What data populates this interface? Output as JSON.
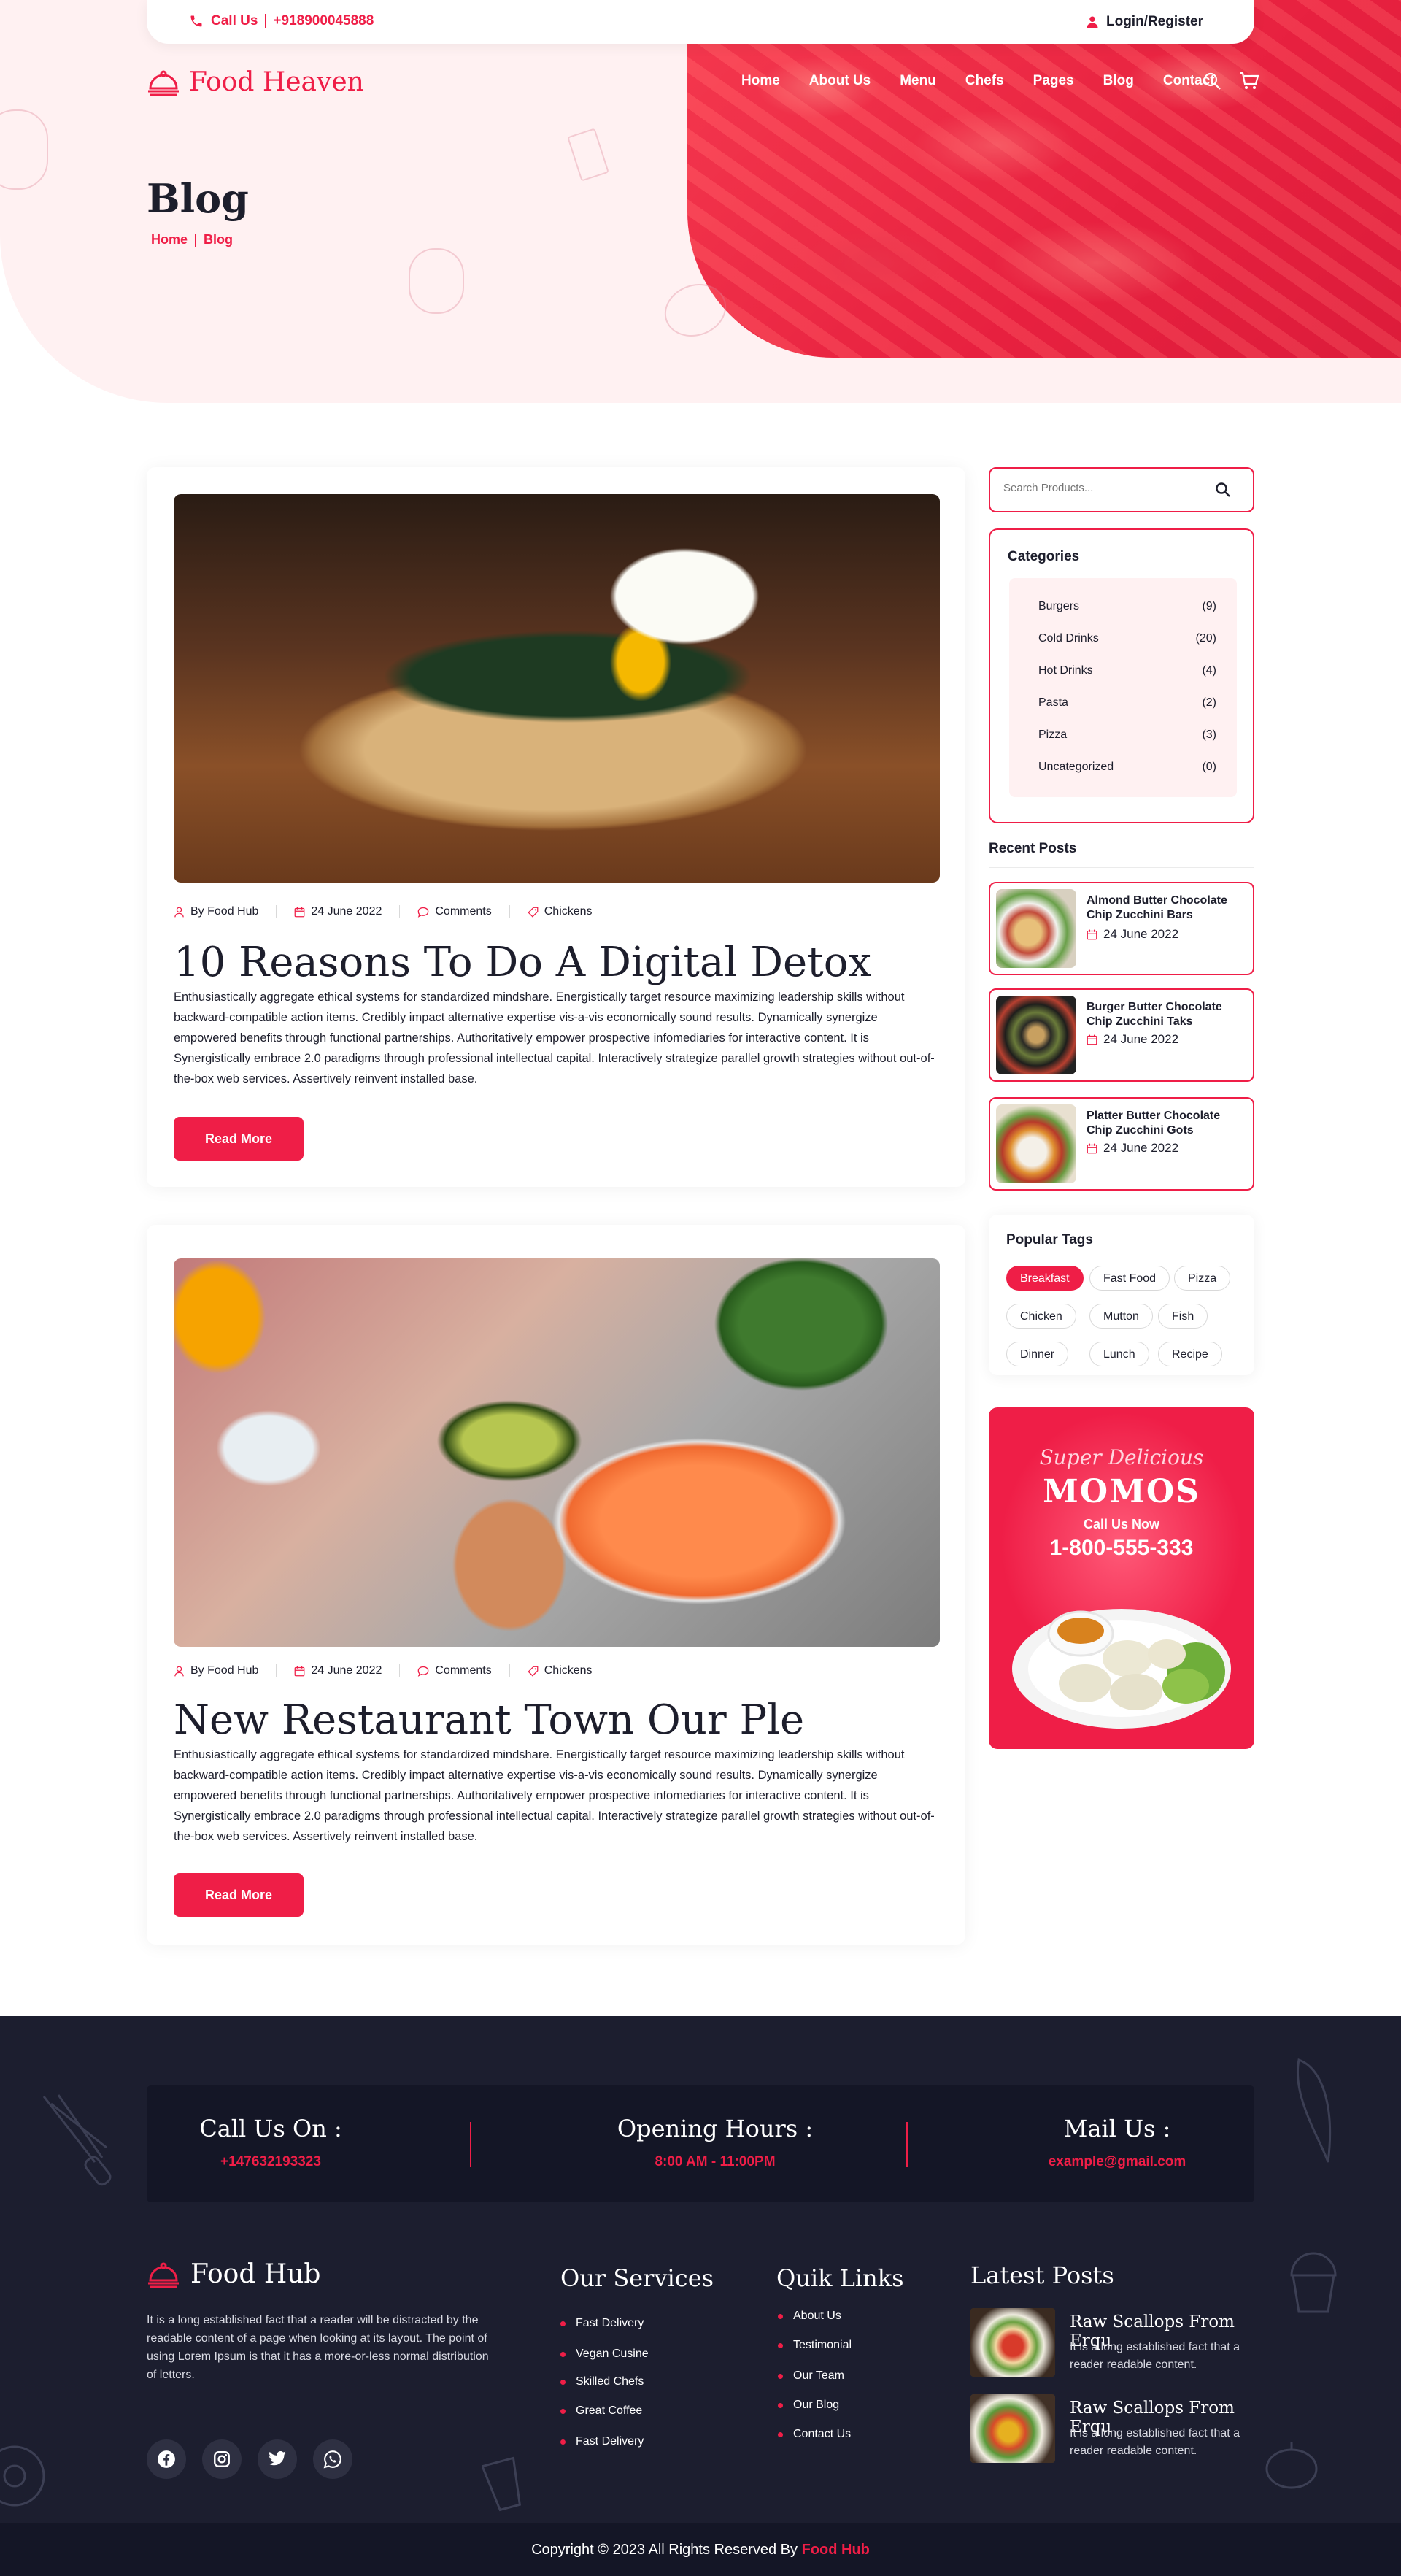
{
  "topbar": {
    "call_label": "Call Us",
    "phone": "+918900045888",
    "login_label": "Login/Register"
  },
  "brand": {
    "name": "Food Heaven"
  },
  "nav": [
    "Home",
    "About Us",
    "Menu",
    "Chefs",
    "Pages",
    "Blog",
    "Contact"
  ],
  "hero": {
    "title": "Blog",
    "breadcrumb": [
      "Home",
      "Blog"
    ]
  },
  "posts": [
    {
      "author": "By Food Hub",
      "date": "24 June 2022",
      "comments": "Comments",
      "category": "Chickens",
      "title": "10 Reasons To Do A Digital Detox",
      "body": "Enthusiastically aggregate ethical systems for standardized mindshare. Energistically target resource maximizing leadership skills without backward-compatible action items. Credibly impact alternative expertise vis-a-vis economically sound results. Dynamically synergize empowered benefits through functional partnerships. Authoritatively empower prospective infomediaries for interactive content. It is Synergistically embrace 2.0 paradigms through professional intellectual capital. Interactively strategize parallel growth strategies without out-of-the-box web services. Assertively reinvent installed base.",
      "button": "Read More"
    },
    {
      "author": "By Food Hub",
      "date": "24 June 2022",
      "comments": "Comments",
      "category": "Chickens",
      "title": "New Restaurant Town Our Ple",
      "body": "Enthusiastically aggregate ethical systems for standardized mindshare. Energistically target resource maximizing leadership skills without backward-compatible action items. Credibly impact alternative expertise vis-a-vis economically sound results. Dynamically synergize empowered benefits through functional partnerships. Authoritatively empower prospective infomediaries for interactive content. It is Synergistically embrace 2.0 paradigms through professional intellectual capital. Interactively strategize parallel growth strategies without out-of-the-box web services. Assertively reinvent installed base.",
      "button": "Read More"
    }
  ],
  "sidebar": {
    "search_placeholder": "Search Products...",
    "categories_title": "Categories",
    "categories": [
      {
        "name": "Burgers",
        "count": "(9)"
      },
      {
        "name": "Cold Drinks",
        "count": "(20)"
      },
      {
        "name": "Hot Drinks",
        "count": "(4)"
      },
      {
        "name": "Pasta",
        "count": "(2)"
      },
      {
        "name": "Pizza",
        "count": "(3)"
      },
      {
        "name": "Uncategorized",
        "count": "(0)"
      }
    ],
    "recent_title": "Recent Posts",
    "recent": [
      {
        "title": "Almond Butter Chocolate Chip Zucchini Bars",
        "date": "24 June 2022"
      },
      {
        "title": "Burger Butter Chocolate Chip Zucchini Taks",
        "date": "24 June 2022"
      },
      {
        "title": "Platter Butter Chocolate Chip Zucchini Gots",
        "date": "24 June 2022"
      }
    ],
    "tags_title": "Popular Tags",
    "tags": [
      "Breakfast",
      "Fast Food",
      "Pizza",
      "Chicken",
      "Mutton",
      "Fish",
      "Dinner",
      "Lunch",
      "Recipe"
    ],
    "promo": {
      "tagline": "Super Delicious",
      "name": "MOMOS",
      "call": "Call Us Now",
      "phone": "1-800-555-333"
    }
  },
  "footer": {
    "contact": [
      {
        "heading": "Call Us On :",
        "value": "+147632193323"
      },
      {
        "heading": "Opening Hours :",
        "value": "8:00 AM - 11:00PM"
      },
      {
        "heading": "Mail Us :",
        "value": "example@gmail.com"
      }
    ],
    "brand": "Food Hub",
    "about": "It is a long established fact that a reader will be distracted by the readable content of a page when looking at its layout. The point of using Lorem Ipsum is that it has a more-or-less normal distribution of letters.",
    "services_title": "Our Services",
    "services": [
      "Fast Delivery",
      "Vegan Cusine",
      "Skilled Chefs",
      "Great Coffee",
      "Fast Delivery"
    ],
    "links_title": "Quik Links",
    "links": [
      "About Us",
      "Testimonial",
      "Our Team",
      "Our Blog",
      "Contact Us"
    ],
    "latest_title": "Latest Posts",
    "latest": [
      {
        "title": "Raw Scallops From Erqu",
        "desc": "It is a long established fact that a reader readable content."
      },
      {
        "title": "Raw Scallops From Erqu",
        "desc": "It is a long established fact that a reader readable content."
      }
    ],
    "copyright_prefix": "Copyright © 2023 All Rights Reserved By",
    "copyright_brand": "Food Hub"
  },
  "colors": {
    "accent": "#ef1e47",
    "dark": "#1c1e2f",
    "hero_bg": "#fff1f2"
  }
}
